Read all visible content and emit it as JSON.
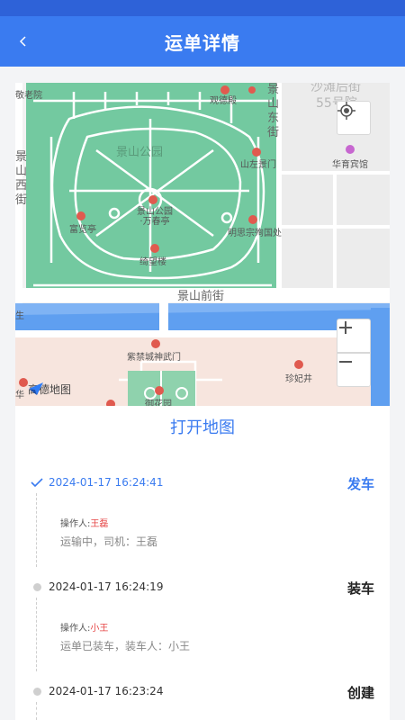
{
  "header": {
    "title": "运单详情",
    "back_icon": "chevron-left-icon"
  },
  "map": {
    "labels": {
      "park": "景山公园",
      "road_jingshan_qian": "景山前街",
      "road_jingshan_dong": "景山东街",
      "road_jingshan_xi": "景山西街",
      "shatan": "沙滩后街",
      "shatan_no": "55号院",
      "guande": "观德殿",
      "shouhuang": "寿皇殿",
      "dongmen": "山左景门",
      "huayu": "华育宾馆",
      "fuwang": "富览亭",
      "wanchunting": "景山公园\n·万春亭",
      "jiwang": "绮望楼",
      "mingsizong": "明思宗殉国处",
      "shenwumen": "紫禁城神武门",
      "zhenfeijing": "珍妃井",
      "yuhuayuan": "御花园",
      "laoshe": "敬老院",
      "dian": "殿",
      "jiedao": "街道办",
      "jing_left": "景",
      "north_left": "生",
      "south_left": "华"
    },
    "logo_text": "高德地图",
    "locate_icon": "crosshair-icon",
    "zoom_in_icon": "plus-icon",
    "zoom_out_icon": "minus-icon"
  },
  "open_map_label": "打开地图",
  "timeline": [
    {
      "time": "2024-01-17 16:24:41",
      "status": "发车",
      "operator_label": "操作人:",
      "operator": "王磊",
      "desc": "运输中，司机：王磊",
      "active": true
    },
    {
      "time": "2024-01-17 16:24:19",
      "status": "装车",
      "operator_label": "操作人:",
      "operator": "小王",
      "desc": "运单已装车，装车人：小王",
      "active": false
    },
    {
      "time": "2024-01-17 16:23:24",
      "status": "创建",
      "active": false
    }
  ],
  "colors": {
    "primary": "#3a7bf0",
    "header": "#3a7bf0",
    "status_bar": "#2e62d8",
    "park": "#73c9a0",
    "water": "#5f9ff0",
    "operator_name": "#e64545"
  }
}
